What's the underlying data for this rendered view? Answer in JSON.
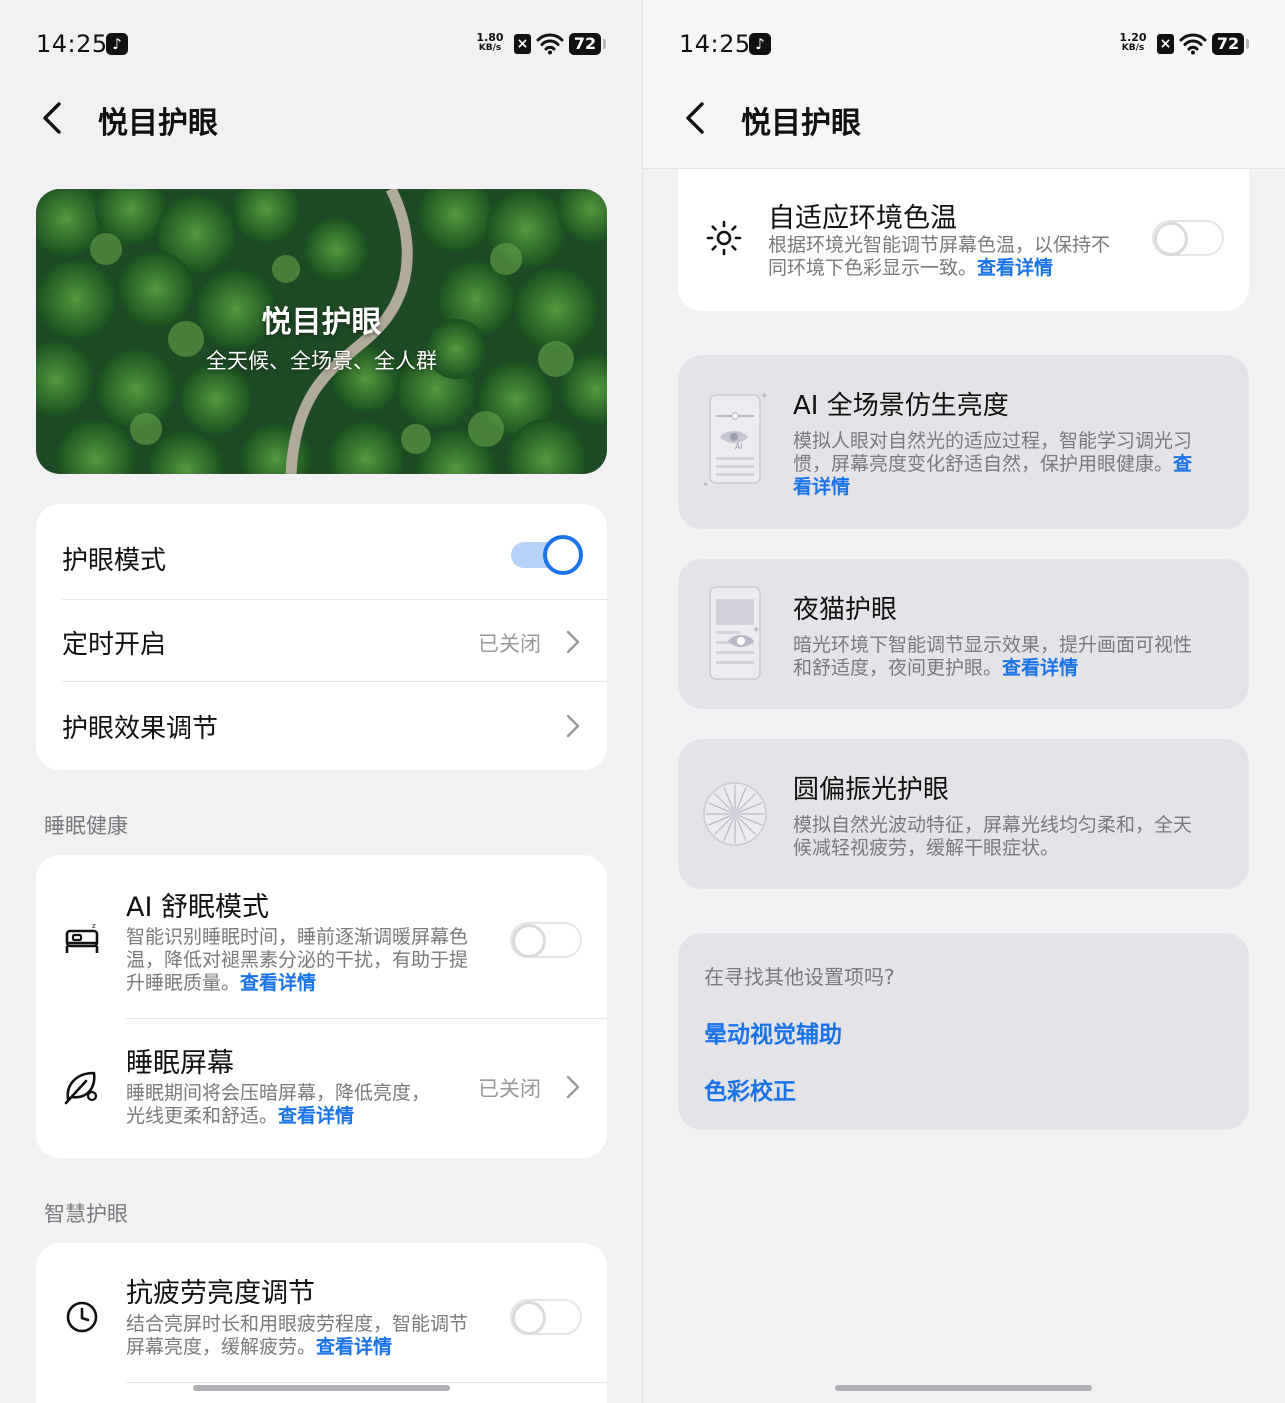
{
  "left": {
    "status": {
      "time": "14:25",
      "net_value": "1.80",
      "net_unit": "KB/s",
      "battery": "72"
    },
    "header": {
      "title": "悦目护眼"
    },
    "hero": {
      "title": "悦目护眼",
      "subtitle": "全天候、全场景、全人群"
    },
    "main_card": {
      "eye_mode": {
        "label": "护眼模式",
        "toggle_on": true
      },
      "schedule": {
        "label": "定时开启",
        "value": "已关闭"
      },
      "effect": {
        "label": "护眼效果调节"
      }
    },
    "sleep_section": {
      "title": "睡眠健康",
      "ai_sleep": {
        "title": "AI 舒眠模式",
        "desc_l1": "智能识别睡眠时间，睡前逐渐调暖屏幕色",
        "desc_l2": "温，降低对褪黑素分泌的干扰，有助于提",
        "desc_l3": "升睡眠质量。",
        "link": "查看详情",
        "toggle_on": false,
        "icon": "bed-icon"
      },
      "sleep_screen": {
        "title": "睡眠屏幕",
        "desc_l1": "睡眠期间将会压暗屏幕，降低亮度，",
        "desc_l2": "光线更柔和舒适。",
        "link": "查看详情",
        "value": "已关闭",
        "icon": "leaf-icon"
      }
    },
    "smart_section": {
      "title": "智慧护眼",
      "anti_fatigue": {
        "title": "抗疲劳亮度调节",
        "desc_l1": "结合亮屏时长和用眼疲劳程度，智能调节",
        "desc_l2": "屏幕亮度，缓解疲劳。",
        "link": "查看详情",
        "toggle_on": false,
        "icon": "clock-icon"
      }
    }
  },
  "right": {
    "status": {
      "time": "14:25",
      "net_value": "1.20",
      "net_unit": "KB/s",
      "battery": "72"
    },
    "header": {
      "title": "悦目护眼"
    },
    "adaptive_color_temp": {
      "title": "自适应环境色温",
      "desc_l1": "根据环境光智能调节屏幕色温，以保持不",
      "desc_l2": "同环境下色彩显示一致。",
      "link": "查看详情",
      "toggle_on": false,
      "icon": "sun-icon"
    },
    "ai_brightness": {
      "title": "AI 全场景仿生亮度",
      "desc_l1": "模拟人眼对自然光的适应过程，智能学习调光习",
      "desc_l2": "惯，屏幕亮度变化舒适自然，保护用眼健康。",
      "link_l2": "查",
      "link_l3": "看详情"
    },
    "night_cat": {
      "title": "夜猫护眼",
      "desc_l1": "暗光环境下智能调节显示效果，提升画面可视性",
      "desc_l2": "和舒适度，夜间更护眼。",
      "link": "查看详情"
    },
    "circular_polarized": {
      "title": "圆偏振光护眼",
      "desc_l1": "模拟自然光波动特征，屏幕光线均匀柔和，全天",
      "desc_l2": "候减轻视疲劳，缓解干眼症状。"
    },
    "search_more": {
      "title": "在寻找其他设置项吗?",
      "links": [
        "晕动视觉辅助",
        "色彩校正"
      ]
    }
  },
  "colors": {
    "accent": "#1a73e8",
    "background": "#f1f1f3",
    "card": "#ffffff",
    "grey_card": "#e4e4e8"
  }
}
